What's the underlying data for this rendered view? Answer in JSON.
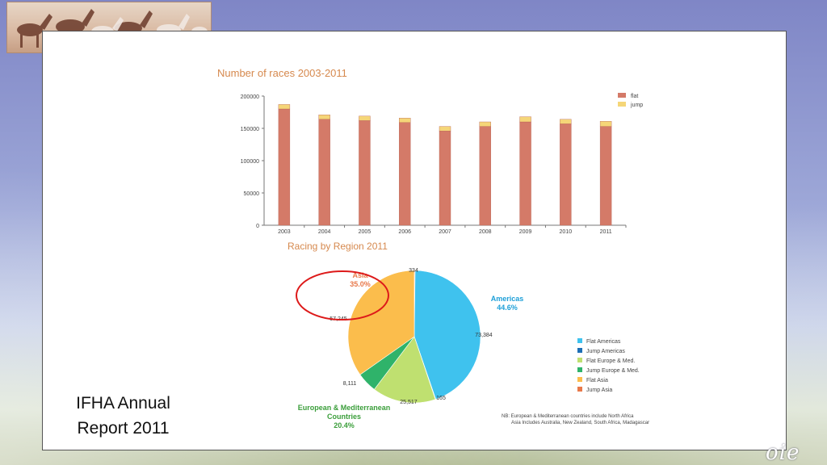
{
  "slide": {
    "caption_line1": "IFHA  Annual",
    "caption_line2": "Report 2011",
    "logo_text": "oie"
  },
  "chart_data": [
    {
      "type": "bar",
      "stacked": true,
      "title": "Number of races 2003-2011",
      "categories": [
        "2003",
        "2004",
        "2005",
        "2006",
        "2007",
        "2008",
        "2009",
        "2010",
        "2011"
      ],
      "series": [
        {
          "name": "flat",
          "color": "#d47a68",
          "values": [
            180000,
            164000,
            162000,
            159000,
            146000,
            153000,
            160000,
            157000,
            153000
          ]
        },
        {
          "name": "jump",
          "color": "#f5d678",
          "values": [
            7000,
            7000,
            7000,
            7000,
            7000,
            7000,
            8000,
            7000,
            8000
          ]
        }
      ],
      "ylim": [
        0,
        200000
      ],
      "yticks": [
        "0",
        "50000",
        "100000",
        "150000",
        "200000"
      ],
      "legend_position": "top-right",
      "grid": false
    },
    {
      "type": "pie",
      "title": "Racing by Region 2011",
      "slices": [
        {
          "name": "Jump Asia",
          "value": 334,
          "color": "#e8794a",
          "value_label": "334"
        },
        {
          "name": "Flat Americas",
          "value": 73384,
          "color": "#3fc2ee",
          "value_label": "73,384"
        },
        {
          "name": "Jump Americas",
          "value": 165,
          "color": "#1d6fb5",
          "value_label": "165"
        },
        {
          "name": "Flat Europe & Med.",
          "value": 25517,
          "color": "#bfe070",
          "value_label": "25,517"
        },
        {
          "name": "Jump Europe & Med.",
          "value": 8111,
          "color": "#2fb36a",
          "value_label": "8,111"
        },
        {
          "name": "Flat Asia",
          "value": 57245,
          "color": "#fbbd4c",
          "value_label": "57,245"
        }
      ],
      "region_labels": {
        "asia_name": "Asia",
        "asia_pct": "35.0%",
        "americas_name": "Americas",
        "americas_pct": "44.6%",
        "europe_line1": "European & Mediterranean",
        "europe_line2": "Countries",
        "europe_pct": "20.4%"
      },
      "legend": [
        "Flat Americas",
        "Jump Americas",
        "Flat Europe & Med.",
        "Jump Europe & Med.",
        "Flat Asia",
        "Jump Asia"
      ],
      "note_line1": "NB: European & Mediterranean countries include North Africa",
      "note_line2": "Asia Includes Australia, New Zealand, South Africa, Madagascar"
    }
  ]
}
